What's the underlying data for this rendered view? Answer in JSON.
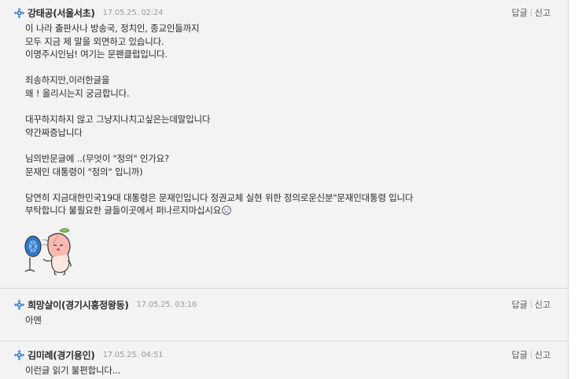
{
  "comments": [
    {
      "author": "강태공(서울서초)",
      "date": "17.05.25. 02:24",
      "reply_label": "답글",
      "report_label": "신고",
      "lines": [
        "이 나라 출판사나 방송국, 정치인, 종교인들까지",
        "모두 지금 제 말을 외면하고 있습니다.",
        "이명주시인님! 여기는 문팬클럽입니다.",
        "",
        "죄송하지만,이러한글을",
        "왜 ! 올리시는지 궁금합니다.",
        "",
        "대꾸하지하지 않고 그냥지나치고싶은는데말입니다",
        "약간짜증납니다",
        "",
        "님의반문글에 ..(무엇이 \"정의\" 인가요?",
        "문재인 대통령이 \"정의\" 입니까)",
        "",
        "당연히 지금대한민국19대 대통령은 문재인입니다 정권교체 실현 위한 정의로운신분\"문재인대통령 입니다",
        "부탁합니다 불필요한 글들이곳에서 퍼나르지마십시요"
      ]
    },
    {
      "author": "희망살이(경기시흥정왕동)",
      "date": "17.05.25. 03:16",
      "reply_label": "답글",
      "report_label": "신고",
      "lines": [
        "아멘"
      ]
    },
    {
      "author": "김미례(경기용인)",
      "date": "17.05.25. 04:51",
      "reply_label": "답글",
      "report_label": "신고",
      "lines": [
        "이런글 읽기 불편합니다..."
      ]
    }
  ],
  "icons": {
    "badge": "cafe-member-badge-icon",
    "emoji": "crying-face-emoji-icon",
    "sticker": "peach-character-with-fan-sticker"
  },
  "colors": {
    "panel_bg": "#f3f3f3",
    "badge_blue": "#3a78c9",
    "date_gray": "#9a9a9a"
  }
}
